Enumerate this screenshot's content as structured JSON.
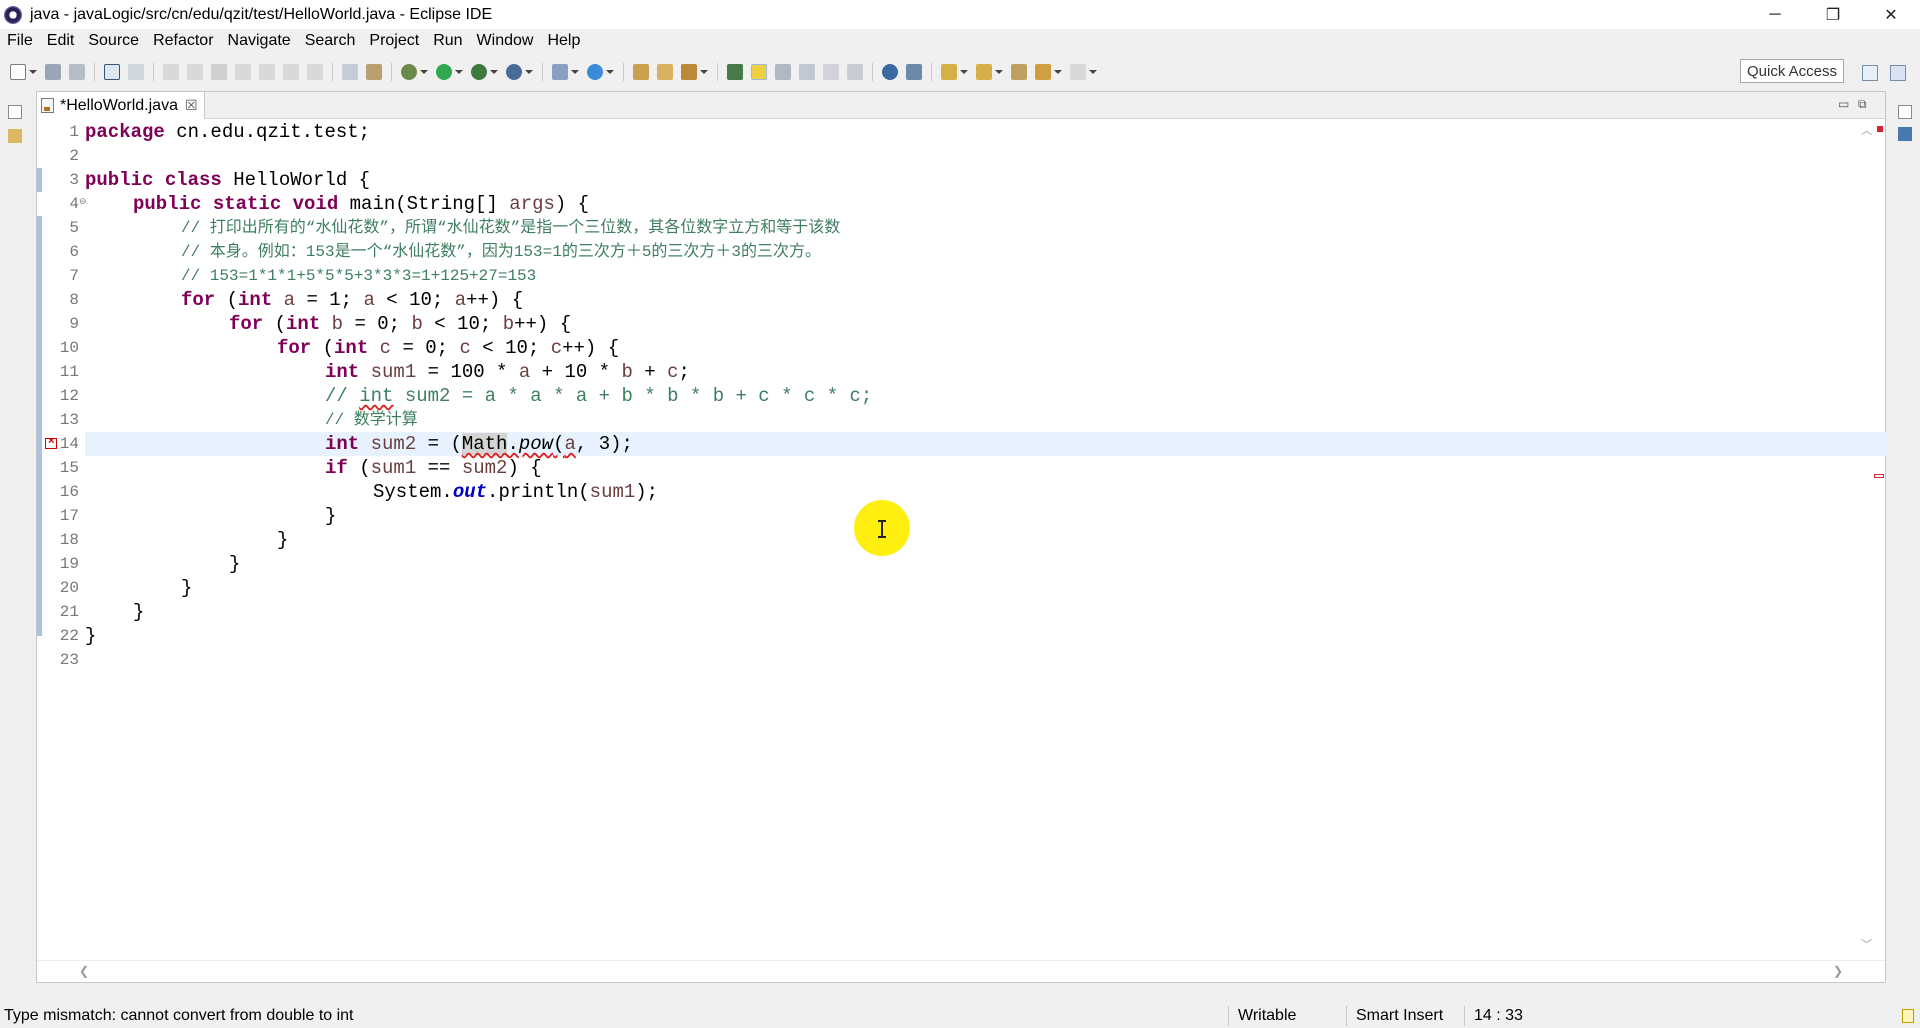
{
  "window": {
    "title": "java - javaLogic/src/cn/edu/qzit/test/HelloWorld.java - Eclipse IDE",
    "minimize": "─",
    "restore": "❐",
    "close": "✕"
  },
  "menu": [
    "File",
    "Edit",
    "Source",
    "Refactor",
    "Navigate",
    "Search",
    "Project",
    "Run",
    "Window",
    "Help"
  ],
  "toolbar": {
    "quick_access": "Quick Access"
  },
  "editor": {
    "tab_label": "*HelloWorld.java",
    "tab_close": "☒",
    "minimize_icon": "▭",
    "maximize_icon": "⧉",
    "line_numbers": [
      "1",
      "2",
      "3",
      "4",
      "5",
      "6",
      "7",
      "8",
      "9",
      "10",
      "11",
      "12",
      "13",
      "14",
      "15",
      "16",
      "17",
      "18",
      "19",
      "20",
      "21",
      "22",
      "23"
    ],
    "current_line": 14,
    "code": {
      "l1_kw": "package",
      "l1_rest": " cn.edu.qzit.test;",
      "l3_kw": "public class",
      "l3_rest": " HelloWorld {",
      "l4_kw": "public static void",
      "l4_rest1": " main(String[] ",
      "l4_var": "args",
      "l4_rest2": ") {",
      "l5_comment": "// 打印出所有的“水仙花数”，所谓“水仙花数”是指一个三位数，其各位数字立方和等于该数",
      "l6_comment": "// 本身。例如：153是一个“水仙花数”，因为153=1的三次方＋5的三次方＋3的三次方。",
      "l7_comment": "// 153=1*1*1+5*5*5+3*3*3=1+125+27=153",
      "l8_kw1": "for",
      "l8_p1": " (",
      "l8_kw2": "int",
      "l8_sp": " ",
      "l8_v1": "a",
      "l8_p2": " = 1; ",
      "l8_v2": "a",
      "l8_p3": " < 10; ",
      "l8_v3": "a",
      "l8_p4": "++) {",
      "l9_kw1": "for",
      "l9_p1": " (",
      "l9_kw2": "int",
      "l9_sp": " ",
      "l9_v1": "b",
      "l9_p2": " = 0; ",
      "l9_v2": "b",
      "l9_p3": " < 10; ",
      "l9_v3": "b",
      "l9_p4": "++) {",
      "l10_kw1": "for",
      "l10_p1": " (",
      "l10_kw2": "int",
      "l10_sp": " ",
      "l10_v1": "c",
      "l10_p2": " = 0; ",
      "l10_v2": "c",
      "l10_p3": " < 10; ",
      "l10_v3": "c",
      "l10_p4": "++) {",
      "l11_kw": "int",
      "l11_sp": " ",
      "l11_v1": "sum1",
      "l11_p1": " = 100 * ",
      "l11_v2": "a",
      "l11_p2": " + 10 * ",
      "l11_v3": "b",
      "l11_p3": " + ",
      "l11_v4": "c",
      "l11_p4": ";",
      "l12_c1": "// ",
      "l12_c2": "int",
      "l12_c3": " sum2 = a * a * a + b * b * b + c * c * c;",
      "l13_comment": "// 数学计算",
      "l14_kw": "int",
      "l14_sp": " ",
      "l14_v1": "sum2",
      "l14_p1": " = (",
      "l14_cls": "Math",
      "l14_dot": ".",
      "l14_meth": "pow",
      "l14_p2": "(",
      "l14_v2": "a",
      "l14_p3": ", 3);",
      "l15_kw": "if",
      "l15_p1": " (",
      "l15_v1": "sum1",
      "l15_p2": " == ",
      "l15_v2": "sum2",
      "l15_p3": ") {",
      "l16_p1": "System.",
      "l16_fld": "out",
      "l16_p2": ".println(",
      "l16_v1": "sum1",
      "l16_p3": ");",
      "l17": "}",
      "l18": "}",
      "l19": "}",
      "l20": "}",
      "l21": "}",
      "l22": "}"
    }
  },
  "status": {
    "message": "Type mismatch: cannot convert from double to int",
    "writable": "Writable",
    "insert_mode": "Smart Insert",
    "position": "14 : 33"
  },
  "colors": {
    "keyword": "#7f0055",
    "comment": "#3f7f5f",
    "local_var": "#6a3e3e",
    "static_field": "#0000c0",
    "current_line": "#e8f2fe",
    "error": "#e0202c",
    "cursor_halo": "#ffef10"
  }
}
